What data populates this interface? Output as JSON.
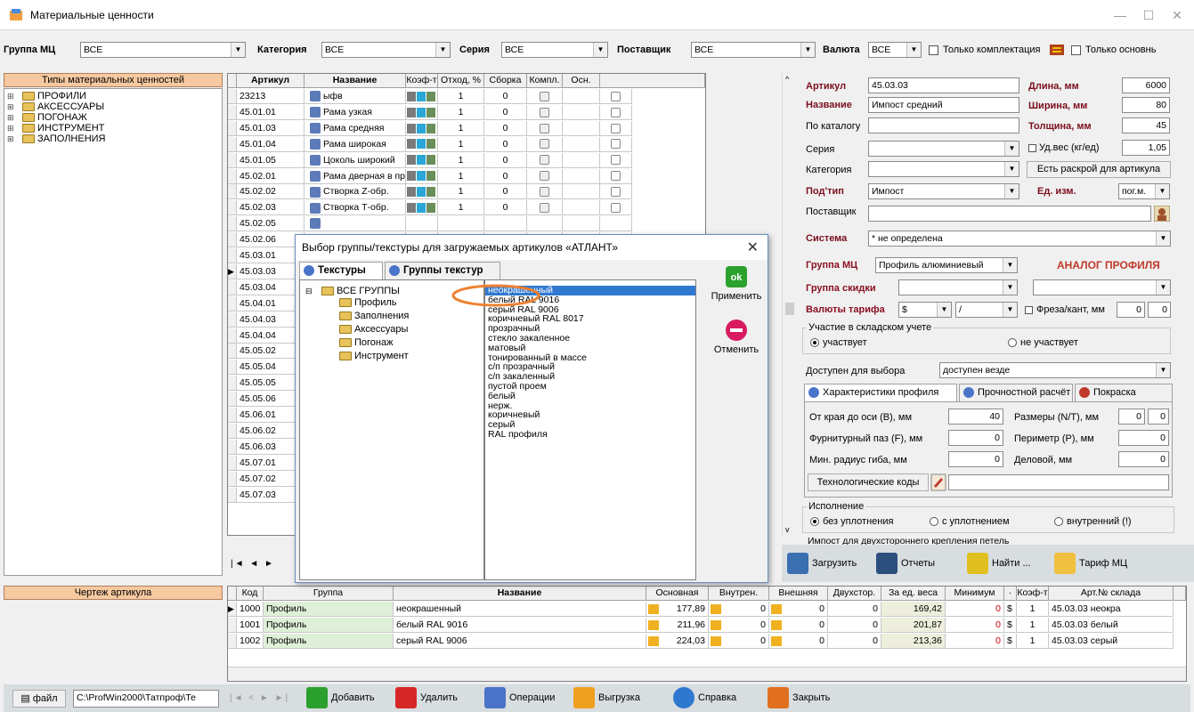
{
  "window": {
    "title": "Материальные ценности"
  },
  "filters": {
    "group_label": "Группа МЦ",
    "group_value": "ВСЕ",
    "category_label": "Категория",
    "category_value": "ВСЕ",
    "series_label": "Серия",
    "series_value": "ВСЕ",
    "supplier_label": "Поставщик",
    "supplier_value": "ВСЕ",
    "currency_label": "Валюта",
    "currency_value": "ВСЕ",
    "only_kit_label": "Только комплектация",
    "only_main_label": "Только основнь"
  },
  "left_tree": {
    "header": "Типы материальных ценностей",
    "items": [
      "ПРОФИЛИ",
      "АКСЕССУАРЫ",
      "ПОГОНАЖ",
      "ИНСТРУМЕНТ",
      "ЗАПОЛНЕНИЯ"
    ]
  },
  "articles": {
    "headers": [
      "Артикул",
      "Название",
      "Коэф-т",
      "Отход, %",
      "Сборка",
      "Компл.",
      "Осн."
    ],
    "rows": [
      {
        "code": "23213",
        "name": "ыфв",
        "k": "1",
        "w": "0"
      },
      {
        "code": "45.01.01",
        "name": "Рама узкая",
        "k": "1",
        "w": "0"
      },
      {
        "code": "45.01.03",
        "name": "Рама средняя",
        "k": "1",
        "w": "0"
      },
      {
        "code": "45.01.04",
        "name": "Рама широкая",
        "k": "1",
        "w": "0"
      },
      {
        "code": "45.01.05",
        "name": "Цоколь широкий",
        "k": "1",
        "w": "0"
      },
      {
        "code": "45.02.01",
        "name": "Рама дверная в проё",
        "k": "1",
        "w": "0"
      },
      {
        "code": "45.02.02",
        "name": "Створка Z-обр.",
        "k": "1",
        "w": "0"
      },
      {
        "code": "45.02.03",
        "name": "Створка Т-обр.",
        "k": "1",
        "w": "0"
      },
      {
        "code": "45.02.05",
        "name": "",
        "k": "",
        "w": ""
      },
      {
        "code": "45.02.06",
        "name": "",
        "k": "",
        "w": ""
      },
      {
        "code": "45.03.01",
        "name": "",
        "k": "",
        "w": ""
      },
      {
        "code": "45.03.03",
        "name": "",
        "k": "",
        "w": ""
      },
      {
        "code": "45.03.04",
        "name": "",
        "k": "",
        "w": ""
      },
      {
        "code": "45.04.01",
        "name": "",
        "k": "",
        "w": ""
      },
      {
        "code": "45.04.03",
        "name": "",
        "k": "",
        "w": ""
      },
      {
        "code": "45.04.04",
        "name": "",
        "k": "",
        "w": ""
      },
      {
        "code": "45.05.02",
        "name": "",
        "k": "",
        "w": ""
      },
      {
        "code": "45.05.04",
        "name": "",
        "k": "",
        "w": ""
      },
      {
        "code": "45.05.05",
        "name": "",
        "k": "",
        "w": ""
      },
      {
        "code": "45.05.06",
        "name": "",
        "k": "",
        "w": ""
      },
      {
        "code": "45.06.01",
        "name": "",
        "k": "",
        "w": ""
      },
      {
        "code": "45.06.02",
        "name": "",
        "k": "",
        "w": ""
      },
      {
        "code": "45.06.03",
        "name": "",
        "k": "",
        "w": ""
      },
      {
        "code": "45.07.01",
        "name": "",
        "k": "",
        "w": ""
      },
      {
        "code": "45.07.02",
        "name": "",
        "k": "",
        "w": ""
      },
      {
        "code": "45.07.03",
        "name": "",
        "k": "",
        "w": ""
      }
    ]
  },
  "props": {
    "article_label": "Артикул",
    "article_value": "45.03.03",
    "length_label": "Длина, мм",
    "length_value": "6000",
    "name_label": "Название",
    "name_value": "Импост средний",
    "width_label": "Ширина, мм",
    "width_value": "80",
    "catalog_label": "По каталогу",
    "catalog_value": "",
    "thickness_label": "Толщина, мм",
    "thickness_value": "45",
    "series_label": "Серия",
    "weight_label": "Уд.вес (кг/ед)",
    "weight_value": "1,05",
    "category_label": "Категория",
    "cut_label": "Есть раскрой для артикула",
    "subtype_label": "Под'тип",
    "subtype_value": "Импост",
    "unit_label": "Ед. изм.",
    "unit_value": "пог.м.",
    "supplier_label": "Поставщик",
    "system_label": "Система",
    "system_value": "* не определена",
    "mc_group_label": "Группа МЦ",
    "mc_group_value": "Профиль алюминиевый",
    "analog_label": "АНАЛОГ ПРОФИЛЯ",
    "discount_label": "Группа скидки",
    "tariff_label": "Валюты тарифа",
    "tariff_value": "$",
    "tariff_sep": "/",
    "mill_label": "Фреза/кант, мм",
    "mill_value1": "0",
    "mill_value2": "0",
    "stock_group": "Участие в складском учете",
    "stock_on": "участвует",
    "stock_off": "не участвует",
    "avail_label": "Доступен для выбора",
    "avail_value": "доступен везде",
    "tabs": [
      "Характеристики профиля",
      "Прочностной расчёт",
      "Покраска"
    ],
    "edge_label": "От края до оси (B), мм",
    "edge_value": "40",
    "sizes_label": "Размеры (N/T), мм",
    "sizes_v1": "0",
    "sizes_v2": "0",
    "groove_label": "Фурнитурный паз (F), мм",
    "groove_value": "0",
    "perimeter_label": "Периметр (P), мм",
    "perimeter_value": "0",
    "radius_label": "Мин. радиус гиба, мм",
    "radius_value": "0",
    "business_label": "Деловой, мм",
    "business_value": "0",
    "tech_label": "Технологические коды",
    "exec_group": "Исполнение",
    "exec_opts": [
      "без уплотнения",
      "с уплотнением",
      "внутренний (!)"
    ],
    "impost_label": "Импост для двухстороннего крепления петель"
  },
  "actions": {
    "load": "Загрузить",
    "reports": "Отчеты",
    "find": "Найти ...",
    "tariff": "Тариф МЦ"
  },
  "drawing": {
    "header": "Чертеж артикула",
    "file_label": "файл",
    "file_path": "C:\\ProfWin2000\\Татпроф\\Те"
  },
  "bottom_grid": {
    "headers": [
      "Код",
      "Группа",
      "Название",
      "Основная",
      "Внутрен.",
      "Внешняя",
      "Двухстор.",
      "За ед. веса",
      "Минимум",
      "·",
      "Коэф-т",
      "Арт.№ склада"
    ],
    "rows": [
      {
        "code": "1000",
        "group": "Профиль",
        "name": "неокрашенный",
        "main": "177,89",
        "inner": "0",
        "outer": "0",
        "two": "0",
        "per_w": "169,42",
        "min": "0",
        "cur": "$",
        "k": "1",
        "art": "45.03.03 неокра",
        "swatch": "#6d6d6d"
      },
      {
        "code": "1001",
        "group": "Профиль",
        "name": "белый RAL 9016",
        "main": "211,96",
        "inner": "0",
        "outer": "0",
        "two": "0",
        "per_w": "201,87",
        "min": "0",
        "cur": "$",
        "k": "1",
        "art": "45.03.03 белый",
        "swatch": "#ffffff"
      },
      {
        "code": "1002",
        "group": "Профиль",
        "name": "серый RAL 9006",
        "main": "224,03",
        "inner": "0",
        "outer": "0",
        "two": "0",
        "per_w": "213,36",
        "min": "0",
        "cur": "$",
        "k": "1",
        "art": "45.03.03 серый",
        "swatch": "#cfcfcf"
      }
    ]
  },
  "bottom_toolbar": {
    "add": "Добавить",
    "delete": "Удалить",
    "ops": "Операции",
    "export": "Выгрузка",
    "help": "Справка",
    "close": "Закрыть"
  },
  "dialog": {
    "title": "Выбор группы/текстуры для загружаемых артикулов «АТЛАНТ»",
    "tab_textures": "Текстуры",
    "tab_groups": "Группы текстур",
    "tree_root": "ВСЕ ГРУППЫ",
    "tree_items": [
      "Профиль",
      "Заполнения",
      "Аксессуары",
      "Погонаж",
      "Инструмент"
    ],
    "list": [
      "неокрашенный",
      "белый RAL 9016",
      "серый RAL 9006",
      "коричневый RAL 8017",
      "прозрачный",
      "стекло закаленное",
      "матовый",
      "тонированный в массе",
      "с/п прозрачный",
      "с/п закаленный",
      "пустой проем",
      "белый",
      "нерж.",
      "коричневый",
      "серый",
      "RAL профиля"
    ],
    "apply": "Применить",
    "ok_icon": "ok",
    "cancel": "Отменить"
  }
}
